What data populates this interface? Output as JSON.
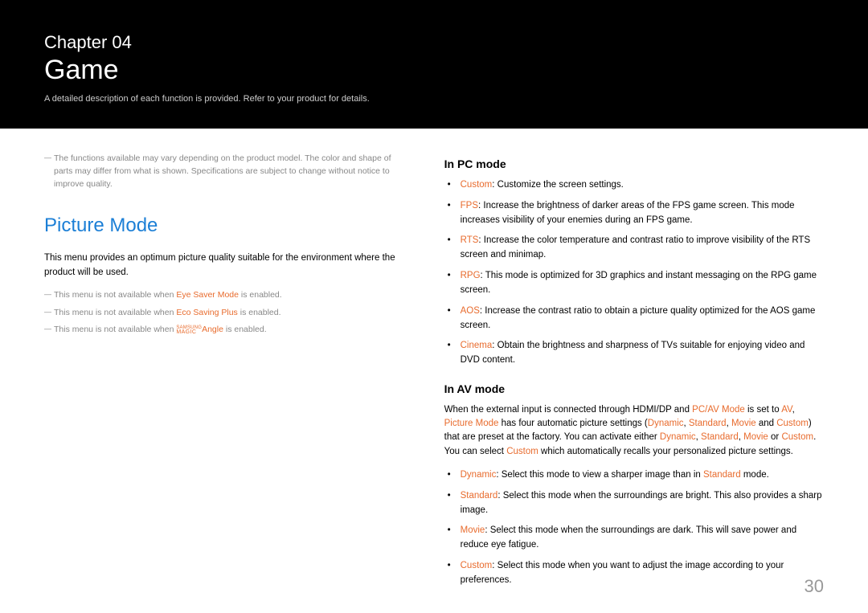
{
  "header": {
    "chapter_label": "Chapter 04",
    "title": "Game",
    "subtitle": "A detailed description of each function is provided. Refer to your product for details."
  },
  "left": {
    "note_top": "The functions available may vary depending on the product model. The color and shape of parts may differ from what is shown. Specifications are subject to change without notice to improve quality.",
    "section_title": "Picture Mode",
    "intro": "This menu provides an optimum picture quality suitable for the environment where the product will be used.",
    "note1_pre": "This menu is not available when ",
    "note1_hl": "Eye Saver Mode",
    "note1_post": " is enabled.",
    "note2_pre": "This menu is not available when ",
    "note2_hl": "Eco Saving Plus",
    "note2_post": " is enabled.",
    "note3_pre": "This menu is not available when ",
    "note3_magic_top": "SAMSUNG",
    "note3_magic_bot": "MAGIC",
    "note3_hl": "Angle",
    "note3_post": " is enabled."
  },
  "right": {
    "pc_heading": "In PC mode",
    "pc": {
      "custom_k": "Custom",
      "custom_v": ": Customize the screen settings.",
      "fps_k": "FPS",
      "fps_v": ": Increase the brightness of darker areas of the FPS game screen. This mode increases visibility of your enemies during an FPS game.",
      "rts_k": "RTS",
      "rts_v": ": Increase the color temperature and contrast ratio to improve visibility of the RTS screen and minimap.",
      "rpg_k": "RPG",
      "rpg_v": ": This mode is optimized for 3D graphics and instant messaging on the RPG game screen.",
      "aos_k": "AOS",
      "aos_v": ": Increase the contrast ratio to obtain a picture quality optimized for the AOS game screen.",
      "cin_k": "Cinema",
      "cin_v": ": Obtain the brightness and sharpness of TVs suitable for enjoying video and DVD content."
    },
    "av_heading": "In AV mode",
    "av_para": {
      "p1": "When the external input is connected through HDMI/DP and ",
      "p2": "PC/AV Mode",
      "p3": " is set to ",
      "p4": "AV",
      "p5": ", ",
      "p6": "Picture Mode",
      "p7": " has four automatic picture settings (",
      "p8": "Dynamic",
      "p9": ", ",
      "p10": "Standard",
      "p11": ", ",
      "p12": "Movie",
      "p13": " and ",
      "p14": "Custom",
      "p15": ") that are preset at the factory. You can activate either ",
      "p16": "Dynamic",
      "p17": ", ",
      "p18": "Standard",
      "p19": ", ",
      "p20": "Movie",
      "p21": " or ",
      "p22": "Custom",
      "p23": ". You can select ",
      "p24": "Custom",
      "p25": " which automatically recalls your personalized picture settings."
    },
    "av": {
      "dyn_k": "Dynamic",
      "dyn_v1": ": Select this mode to view a sharper image than in ",
      "dyn_std": "Standard",
      "dyn_v2": " mode.",
      "std_k": "Standard",
      "std_v": ": Select this mode when the surroundings are bright. This also provides a sharp image.",
      "mov_k": "Movie",
      "mov_v": ": Select this mode when the surroundings are dark. This will save power and reduce eye fatigue.",
      "cus_k": "Custom",
      "cus_v": ": Select this mode when you want to adjust the image according to your preferences."
    }
  },
  "page_number": "30"
}
